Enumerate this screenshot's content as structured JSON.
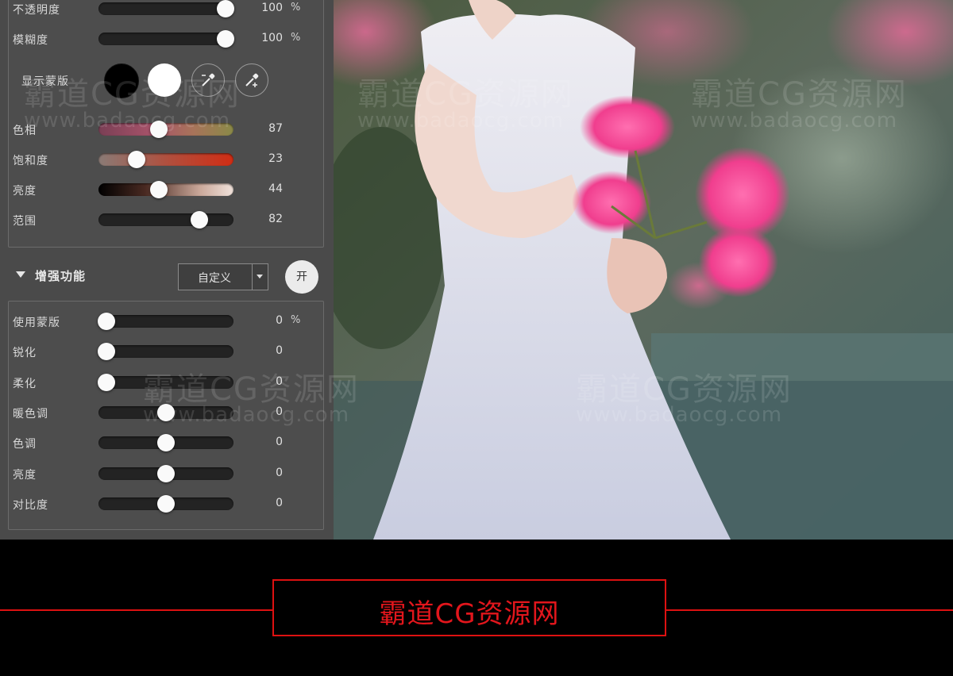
{
  "top_sliders": [
    {
      "label": "不透明度",
      "value": "100",
      "unit": "%",
      "level": 1.0,
      "style": "dark"
    },
    {
      "label": "模糊度",
      "value": "100",
      "unit": "%",
      "level": 1.0,
      "style": "dark"
    }
  ],
  "mask": {
    "label": "显示蒙版",
    "swatch_colors": [
      "#000000",
      "#ffffff"
    ],
    "tools": [
      "eyedropper-minus-icon",
      "eyedropper-plus-icon"
    ]
  },
  "color_sliders": [
    {
      "label": "色相",
      "value": "87",
      "level": 0.44,
      "style": "hue"
    },
    {
      "label": "饱和度",
      "value": "23",
      "level": 0.25,
      "style": "sat"
    },
    {
      "label": "亮度",
      "value": "44",
      "level": 0.44,
      "style": "bri"
    },
    {
      "label": "范围",
      "value": "82",
      "level": 0.78,
      "style": "dark"
    }
  ],
  "enhance": {
    "title": "增强功能",
    "preset": "自定义",
    "toggle": "开",
    "sliders": [
      {
        "label": "使用蒙版",
        "value": "0",
        "unit": "%",
        "level": 0.0
      },
      {
        "label": "锐化",
        "value": "0",
        "level": 0.0
      },
      {
        "label": "柔化",
        "value": "0",
        "level": 0.0
      },
      {
        "label": "暖色调",
        "value": "0",
        "level": 0.5
      },
      {
        "label": "色调",
        "value": "0",
        "level": 0.5
      },
      {
        "label": "亮度",
        "value": "0",
        "level": 0.5
      },
      {
        "label": "对比度",
        "value": "0",
        "level": 0.5
      }
    ]
  },
  "watermark": {
    "text": "霸道CG资源网",
    "url": "www.badaocg.com"
  },
  "banner": {
    "brand": "霸道CG资源网",
    "accent": "#e2161c"
  }
}
